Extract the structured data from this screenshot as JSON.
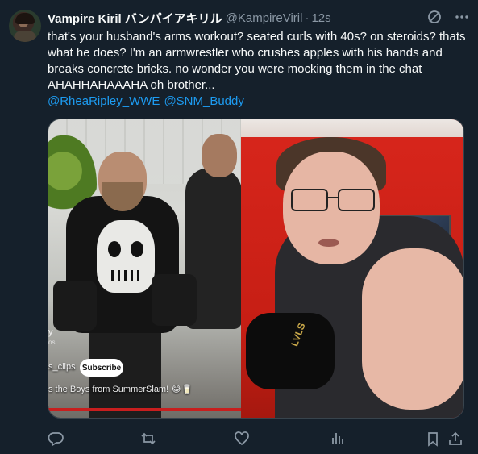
{
  "tweet": {
    "display_name": "Vampire Kiril バンパイアキリル",
    "handle": "@KampireViril",
    "separator": "·",
    "timestamp": "12s",
    "text": "that's your husband's arms workout? seated curls with 40s? on steroids? thats what he does? I'm an armwrestler who crushes apples with his hands and breaks concrete bricks. no wonder you were mocking them in the chat AHAHHAHAAAHA oh brother...",
    "mentions": [
      "@RheaRipley_WWE",
      "@SNM_Buddy"
    ]
  },
  "media": {
    "left_overlay": {
      "side_letter": "y",
      "side_small": "os",
      "channel_fragment": "s_clips",
      "subscribe_label": "Subscribe",
      "caption": "s the Boys from SummerSlam! 😂🥛"
    },
    "right_overlay": {
      "wrap_text": "LVLS"
    }
  },
  "icons": {
    "header": [
      "grok-icon",
      "more-icon"
    ],
    "actions": [
      "reply-icon",
      "retweet-icon",
      "like-icon",
      "views-icon",
      "bookmark-icon",
      "share-icon"
    ]
  },
  "colors": {
    "background": "#15202b",
    "text": "#f7f9f9",
    "secondary": "#8b98a5",
    "link": "#1d9bf0"
  }
}
